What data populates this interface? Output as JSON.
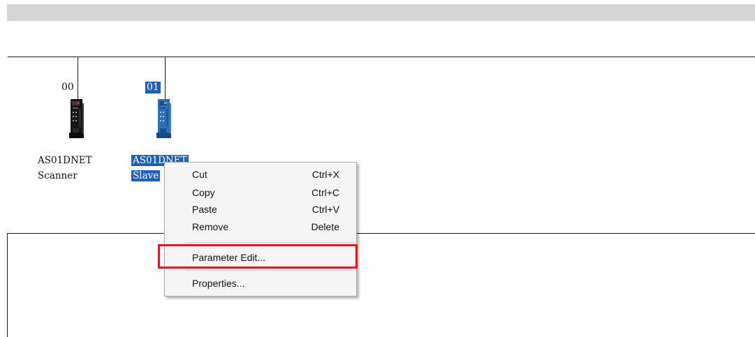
{
  "nodes": [
    {
      "address": "00",
      "label_line1": "AS01DNET",
      "label_line2": "Scanner",
      "selected": false,
      "icon": "plc-module-icon",
      "color": "#1a1a1a"
    },
    {
      "address": "01",
      "label_line1": "AS01DNET",
      "label_line2": "Slave",
      "selected": true,
      "icon": "plc-module-icon",
      "color": "#2e6db4"
    }
  ],
  "context_menu": {
    "items": [
      {
        "label": "Cut",
        "shortcut": "Ctrl+X"
      },
      {
        "label": "Copy",
        "shortcut": "Ctrl+C"
      },
      {
        "label": "Paste",
        "shortcut": "Ctrl+V"
      },
      {
        "label": "Remove",
        "shortcut": "Delete"
      },
      {
        "label": "Parameter Edit...",
        "shortcut": ""
      },
      {
        "label": "Properties...",
        "shortcut": ""
      }
    ],
    "highlighted_item": "Parameter Edit...",
    "highlight_color": "#e8141d"
  },
  "colors": {
    "selection": "#1c61b3",
    "menu_background": "#f5f5f5",
    "title_bar": "#d4d4d4"
  }
}
